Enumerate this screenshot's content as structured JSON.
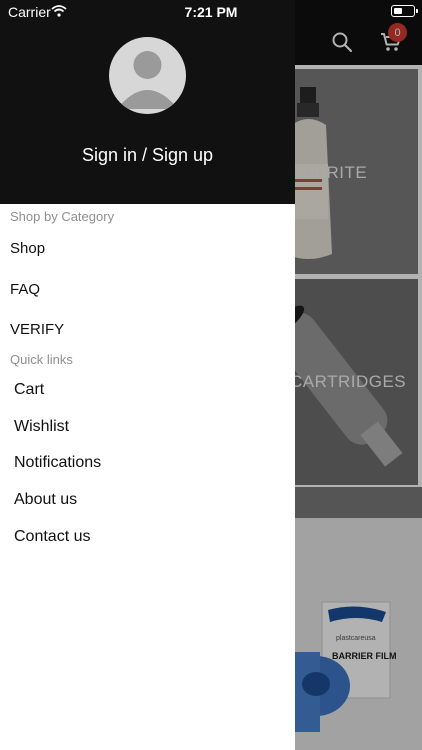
{
  "status_bar": {
    "carrier": "Carrier",
    "time": "7:21 PM"
  },
  "drawer": {
    "sign_in_label": "Sign in / Sign up",
    "shop_by_category": {
      "label": "Shop by Category",
      "items": [
        "Shop",
        "FAQ",
        "VERIFY"
      ]
    },
    "quick_links": {
      "label": "Quick links",
      "items": [
        "Cart",
        "Wishlist",
        "Notifications",
        "About us",
        "Contact us"
      ]
    }
  },
  "background": {
    "cart_badge_count": "0",
    "tiles": [
      "ARBRITE",
      "CARTRIDGES"
    ],
    "product_box_label": "BARRIER FILM",
    "product_brand": "plastcareusa"
  },
  "colors": {
    "header_bg": "#111111",
    "badge_red": "#d63a32",
    "section_label_gray": "#8f8f8f"
  }
}
